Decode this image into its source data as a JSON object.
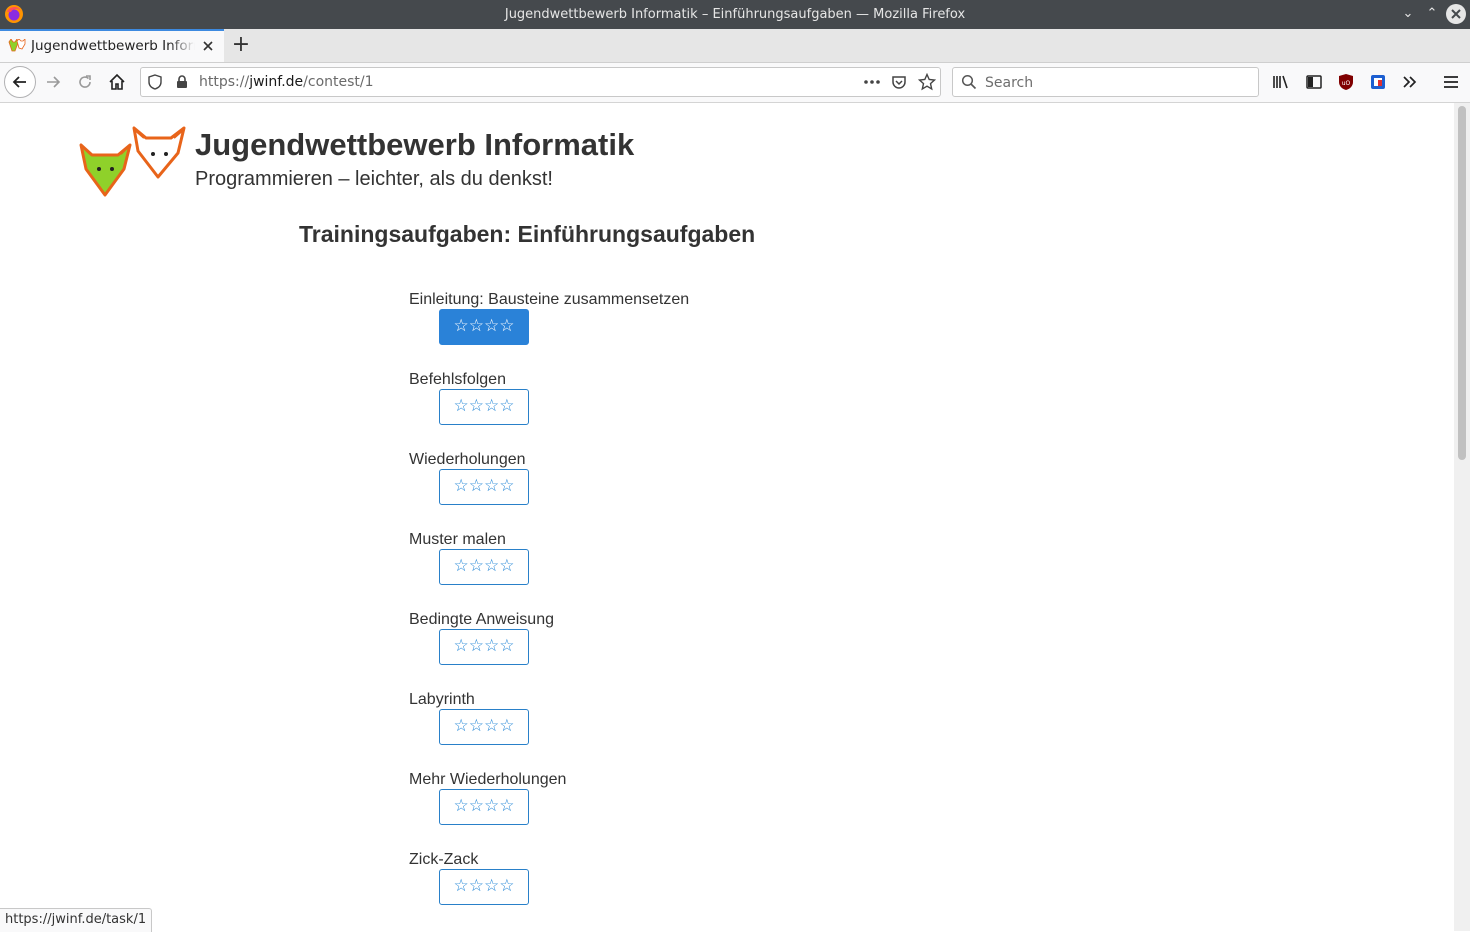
{
  "window": {
    "title": "Jugendwettbewerb Informatik – Einführungsaufgaben — Mozilla Firefox",
    "minimize_glyph": "⌄",
    "maximize_glyph": "⌃",
    "close_glyph": "✕"
  },
  "tabs": [
    {
      "label": "Jugendwettbewerb Informatik – Einführungsaufgaben",
      "favicon": "jwinf-foxes-icon",
      "active": true
    }
  ],
  "tabbar": {
    "new_tab_glyph": "+"
  },
  "navbar": {
    "url_prefix": "https://",
    "url_domain": "jwinf.de",
    "url_path": "/contest/1",
    "search_placeholder": "Search"
  },
  "page": {
    "site_title": "Jugendwettbewerb Informatik",
    "site_subtitle": "Programmieren – leichter, als du denkst!",
    "contest_title": "Trainingsaufgaben: Einführungsaufgaben",
    "tasks": [
      {
        "name": "Einleitung: Bausteine zusammensetzen",
        "stars": "☆☆☆☆",
        "highlighted": true
      },
      {
        "name": "Befehlsfolgen",
        "stars": "☆☆☆☆",
        "highlighted": false
      },
      {
        "name": "Wiederholungen",
        "stars": "☆☆☆☆",
        "highlighted": false
      },
      {
        "name": "Muster malen",
        "stars": "☆☆☆☆",
        "highlighted": false
      },
      {
        "name": "Bedingte Anweisung",
        "stars": "☆☆☆☆",
        "highlighted": false
      },
      {
        "name": "Labyrinth",
        "stars": "☆☆☆☆",
        "highlighted": false
      },
      {
        "name": "Mehr Wiederholungen",
        "stars": "☆☆☆☆",
        "highlighted": false
      },
      {
        "name": "Zick-Zack",
        "stars": "☆☆☆☆",
        "highlighted": false
      }
    ]
  },
  "statusbar": {
    "link": "https://jwinf.de/task/1"
  },
  "colors": {
    "accent": "#2a82d8",
    "title_bar": "#45494d",
    "fox_green": "#8fd12a",
    "fox_orange": "#e8641a"
  }
}
